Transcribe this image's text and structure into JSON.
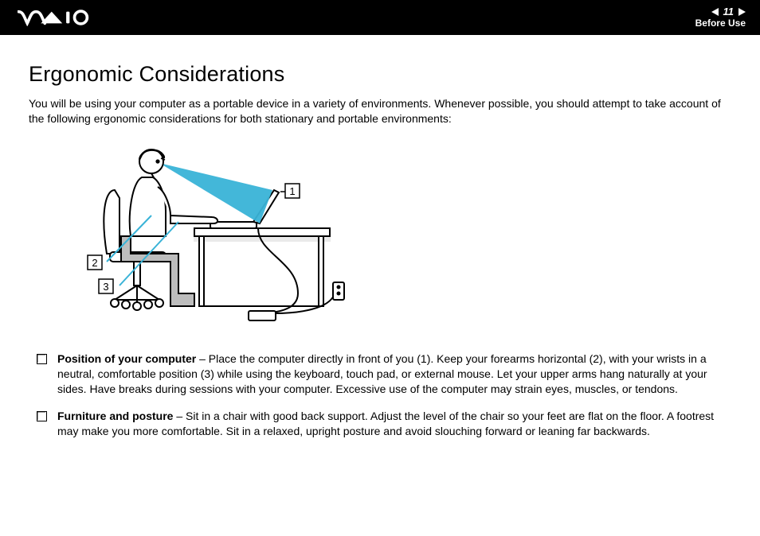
{
  "header": {
    "brand": "VAIO",
    "page_number": "11",
    "section": "Before Use"
  },
  "title": "Ergonomic Considerations",
  "intro": "You will be using your computer as a portable device in a variety of environments. Whenever possible, you should attempt to take account of the following ergonomic considerations for both stationary and portable environments:",
  "figure": {
    "callouts": {
      "one": "1",
      "two": "2",
      "three": "3"
    }
  },
  "bullets": [
    {
      "title": "Position of your computer",
      "text": " – Place the computer directly in front of you (1). Keep your forearms horizontal (2), with your wrists in a neutral, comfortable position (3) while using the keyboard, touch pad, or external mouse. Let your upper arms hang naturally at your sides. Have breaks during sessions with your computer. Excessive use of the computer may strain eyes, muscles, or tendons."
    },
    {
      "title": "Furniture and posture",
      "text": " – Sit in a chair with good back support. Adjust the level of the chair so your feet are flat on the floor. A footrest may make you more comfortable. Sit in a relaxed, upright posture and avoid slouching forward or leaning far backwards."
    }
  ]
}
